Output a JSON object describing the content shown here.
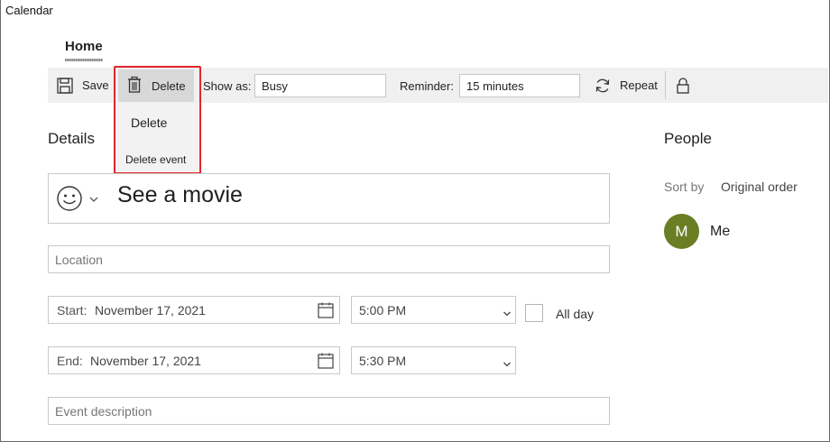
{
  "app": {
    "title": "Calendar"
  },
  "tabs": [
    {
      "label": "Home"
    }
  ],
  "toolbar": {
    "save_label": "Save",
    "delete_label": "Delete",
    "show_as_label": "Show as:",
    "show_as_value": "Busy",
    "reminder_label": "Reminder:",
    "reminder_value": "15 minutes",
    "repeat_label": "Repeat"
  },
  "delete_menu": {
    "items": [
      {
        "label": "Delete"
      },
      {
        "label": "Delete event"
      }
    ]
  },
  "details": {
    "heading": "Details",
    "event_title": "See a movie",
    "location_placeholder": "Location",
    "start_label": "Start:",
    "start_date": "November 17, 2021",
    "start_time": "5:00 PM",
    "all_day_label": "All day",
    "end_label": "End:",
    "end_date": "November 17, 2021",
    "end_time": "5:30 PM",
    "description_placeholder": "Event description"
  },
  "people": {
    "heading": "People",
    "sort_label": "Sort by",
    "sort_value": "Original order",
    "members": [
      {
        "initial": "M",
        "name": "Me"
      }
    ]
  },
  "colors": {
    "highlight": "#e3262b",
    "avatar": "#6b7e24",
    "toolbar_bg": "#f0f0f0"
  }
}
